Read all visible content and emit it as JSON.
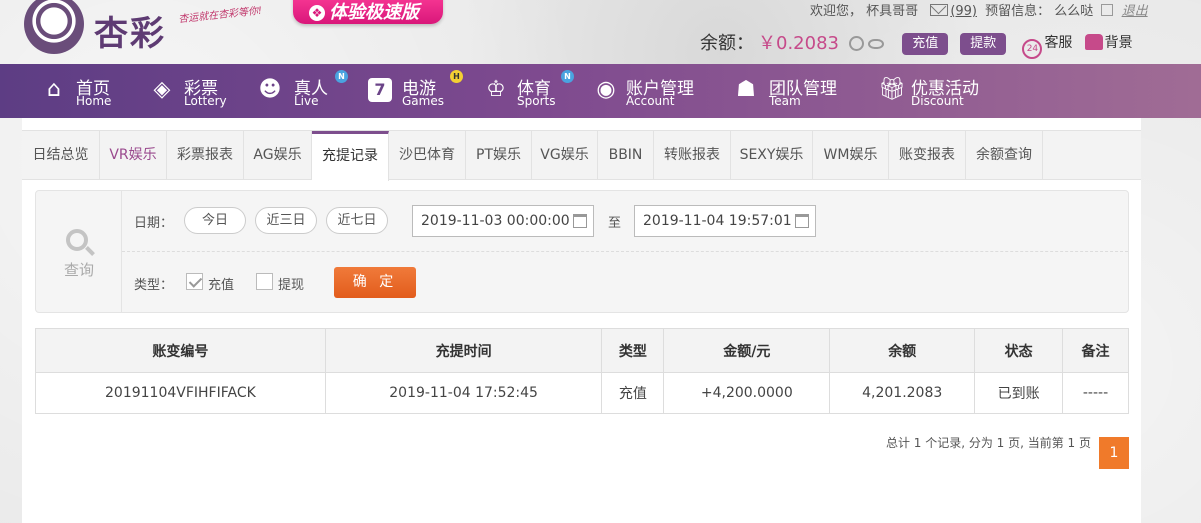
{
  "brand": {
    "name": "杏彩",
    "slogan": "杏运就在杏彩等你!",
    "promo": "体验极速版"
  },
  "user_bar": {
    "welcome_prefix": "欢迎您，",
    "username": "杯具哥哥",
    "messages": "(99)",
    "reserve_prefix": "预留信息：",
    "reserve_text": "么么哒",
    "logout": "退出"
  },
  "balance": {
    "label": "余额：",
    "amount": "￥0.2083",
    "deposit": "充值",
    "withdraw": "提款",
    "service": "客服",
    "service_badge": "24",
    "background": "背景"
  },
  "nav": [
    {
      "zh": "首页",
      "en": "Home",
      "icon": "home-icon"
    },
    {
      "zh": "彩票",
      "en": "Lottery",
      "icon": "ticket-icon"
    },
    {
      "zh": "真人",
      "en": "Live",
      "icon": "dealer-icon",
      "badge": "N"
    },
    {
      "zh": "电游",
      "en": "Games",
      "icon": "slot-seven-icon",
      "badge": "H"
    },
    {
      "zh": "体育",
      "en": "Sports",
      "icon": "trophy-icon",
      "badge": "N"
    },
    {
      "zh": "账户管理",
      "en": "Account",
      "icon": "account-icon"
    },
    {
      "zh": "团队管理",
      "en": "Team",
      "icon": "team-icon"
    },
    {
      "zh": "优惠活动",
      "en": "Discount",
      "icon": "gift-icon"
    }
  ],
  "tabs": [
    "日结总览",
    "VR娱乐",
    "彩票报表",
    "AG娱乐",
    "充提记录",
    "沙巴体育",
    "PT娱乐",
    "VG娱乐",
    "BBIN",
    "转账报表",
    "SEXY娱乐",
    "WM娱乐",
    "账变报表",
    "余额查询"
  ],
  "active_tab": "充提记录",
  "query": {
    "side_label": "查询",
    "date_label": "日期：",
    "ranges": [
      "今日",
      "近三日",
      "近七日"
    ],
    "start": "2019-11-03 00:00:00",
    "to": "至",
    "end": "2019-11-04 19:57:01",
    "type_label": "类型：",
    "types": [
      {
        "label": "充值",
        "checked": true
      },
      {
        "label": "提现",
        "checked": false
      }
    ],
    "confirm": "确 定"
  },
  "table": {
    "headers": [
      "账变编号",
      "充提时间",
      "类型",
      "金额/元",
      "余额",
      "状态",
      "备注"
    ],
    "rows": [
      [
        "20191104VFIHFIFACK",
        "2019-11-04 17:52:45",
        "充值",
        "+4,200.0000",
        "4,201.2083",
        "已到账",
        "-----"
      ]
    ]
  },
  "pager": {
    "summary": "总计 1 个记录, 分为 1 页, 当前第 1 页",
    "current": "1"
  },
  "colors": {
    "nav_start": "#5d3d84",
    "nav_end": "#a06c95",
    "accent_purple": "#7d4e8d",
    "orange": "#e25c1c",
    "amount_red": "#c62828",
    "status_green": "#2e9a2e"
  }
}
